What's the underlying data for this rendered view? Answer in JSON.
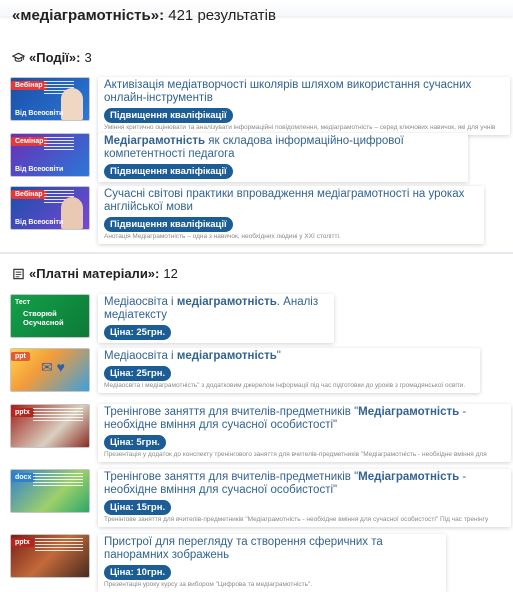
{
  "search": {
    "query": "«медіаграмотність»:",
    "count_text": "421 результатів"
  },
  "events": {
    "label": "«Події»:",
    "count": "3",
    "icon": "graduation-cap-icon",
    "items": [
      {
        "thumb_tag": "Вебінар",
        "thumb_from": "Від Всеосвіти",
        "thumb_color": "#e23a3a",
        "title": "Активізація медіатворчості школярів шляхом використання сучасних онлайн-інструментів",
        "badge": "Підвищення кваліфікації",
        "desc": "Уміння критично оцінювати та аналізувати інформаційні повідомлення, медіаграмотність – серед ключових навичок, які для учнів"
      },
      {
        "thumb_tag": "Семінар",
        "thumb_from": "Від Всеосвіти",
        "thumb_color": "#e23a3a",
        "title_bold": "Медіаграмотність",
        "title_rest": " як складова інформаційно-цифрової компетентності педагога",
        "badge": "Підвищення кваліфікації",
        "desc": ""
      },
      {
        "thumb_tag": "Вебінар",
        "thumb_from": "Від Всеосвіти",
        "thumb_color": "#e23a3a",
        "title": "Сучасні світові практики впровадження медіаграмотності на уроках англійської мови",
        "badge": "Підвищення кваліфікації",
        "desc": "Анотація Медіаграмотність – одна з навичок, необхідних людині у XXI столітті."
      }
    ]
  },
  "paid": {
    "label": "«Платні матеріали»:",
    "count": "12",
    "icon": "document-icon",
    "items": [
      {
        "thumb_tag": "Тест",
        "thumb_text": "Створюй Осучасной",
        "thumb_color": "#1a7f3a",
        "title_pre": "Медіаосвіта і ",
        "title_bold": "медіаграмотність",
        "title_rest": ". Аналіз медіатексту",
        "badge": "Ціна: 25грн.",
        "desc": ""
      },
      {
        "thumb_tag": "ppt",
        "thumb_color": "#e25c2f",
        "title_pre": "Медіаосвіта і ",
        "title_bold": "медіаграмотність",
        "title_rest": "\"",
        "badge": "Ціна: 25грн.",
        "desc": "Медіаосвіта і медіаграмотність\" з додатковим джерелом інформації під час підготовки до уроків з громадянської освіти."
      },
      {
        "thumb_tag": "pptx",
        "thumb_color": "#b3261e",
        "title_pre": "Тренінгове заняття для вчителів-предметників \"",
        "title_bold": "Медіаграмотність",
        "title_rest": " - необхідне вміння для сучасної особистості\"",
        "badge": "Ціна: 5грн.",
        "desc": "Презентація у додаток до конспекту тренінгового заняття для вчителів-предметників \"Медіаграмотність - необхідне вміння для"
      },
      {
        "thumb_tag": "docx",
        "thumb_color": "#2f7fd0",
        "title_pre": "Тренінгове заняття для вчителів-предметників \"",
        "title_bold": "Медіаграмотність",
        "title_rest": " - необхідне вміння для сучасної особистості\"",
        "badge": "Ціна: 15грн.",
        "desc": "Тренінгове заняття для вчителів-предметників \"Медіаграмотність - необхідне вміння для сучасної особистості\" Під час тренінгу"
      },
      {
        "thumb_tag": "pptx",
        "thumb_color": "#b3261e",
        "title": "Пристрої для перегляду та створення сферичних та панорамних зображень",
        "badge": "Ціна: 10грн.",
        "desc": "Презентація уроку курсу за вибором \"Цифрова та медіаграмотність\"."
      }
    ]
  }
}
